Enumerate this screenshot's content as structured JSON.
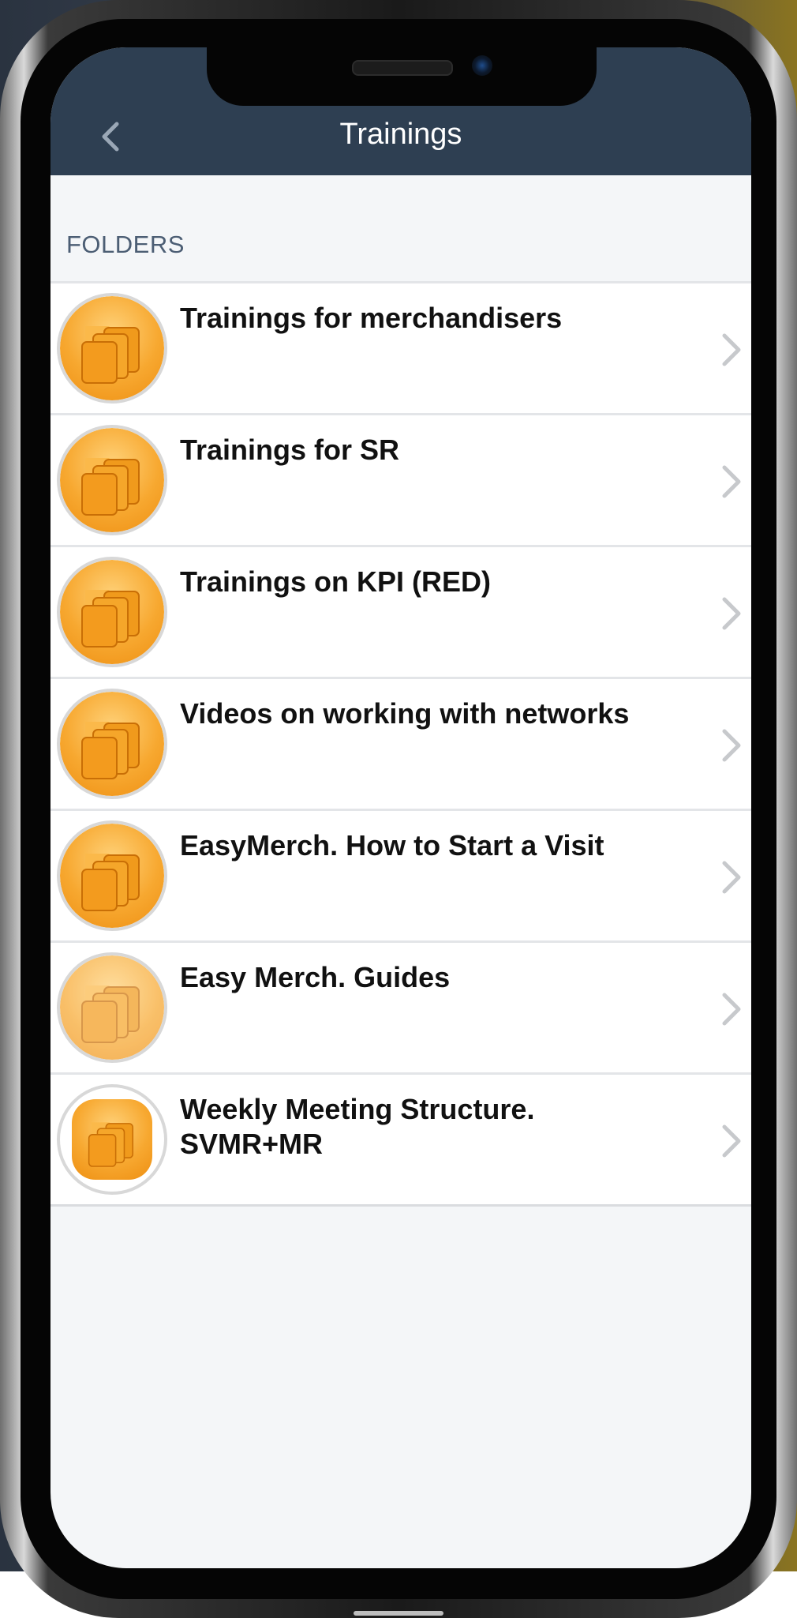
{
  "header": {
    "title": "Trainings",
    "back_icon": "chevron-left-icon"
  },
  "section": {
    "label": "FOLDERS"
  },
  "folders": [
    {
      "label": "Trainings for merchandisers",
      "icon": "folder-icon"
    },
    {
      "label": "Trainings for SR",
      "icon": "folder-icon"
    },
    {
      "label": "Trainings on KPI (RED)",
      "icon": "folder-icon"
    },
    {
      "label": "Videos on working with networks",
      "icon": "folder-icon"
    },
    {
      "label": "EasyMerch. How to Start a Visit",
      "icon": "folder-icon"
    },
    {
      "label": "Easy Merch. Guides",
      "icon": "folder-icon"
    },
    {
      "label": "Weekly Meeting Structure. SVMR+MR",
      "icon": "folder-icon"
    }
  ],
  "colors": {
    "header_bg": "#2e3f52",
    "folder_orange": "#f7a830",
    "section_label": "#4c5e74",
    "screen_bg": "#f4f6f8"
  }
}
